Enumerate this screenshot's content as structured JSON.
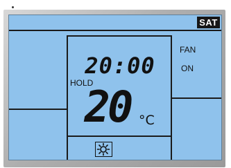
{
  "display": {
    "day": "SAT",
    "clock": "20:00",
    "hold_label": "HOLD",
    "temperature": "20",
    "unit": "°C",
    "fan_label": "FAN",
    "fan_state": "ON",
    "mode_icon": "sun-icon"
  },
  "colors": {
    "lcd_background": "#8fc2ec",
    "segment": "#111111",
    "bezel": "#aeaeae"
  }
}
